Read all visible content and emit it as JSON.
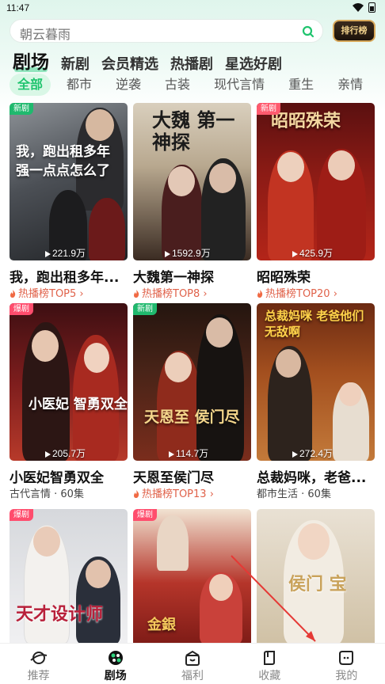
{
  "status_bar": {
    "time": "11:47"
  },
  "search": {
    "placeholder": "朝云暮雨",
    "rank_button": "排行榜"
  },
  "main_tabs": [
    {
      "label": "剧场",
      "active": true
    },
    {
      "label": "新剧"
    },
    {
      "label": "会员精选"
    },
    {
      "label": "热播剧"
    },
    {
      "label": "星选好剧"
    }
  ],
  "sub_tabs": [
    {
      "label": "全部",
      "active": true
    },
    {
      "label": "都市"
    },
    {
      "label": "逆袭"
    },
    {
      "label": "古装"
    },
    {
      "label": "现代言情"
    },
    {
      "label": "重生"
    },
    {
      "label": "亲情"
    }
  ],
  "cards": [
    {
      "badge": "新剧",
      "badge_type": "new",
      "poster_text": "我，跑出租多年 强一点点怎么了",
      "views": "221.9万",
      "title": "我，跑出租多年...",
      "meta": "热播榜TOP5",
      "meta_type": "rank"
    },
    {
      "badge": "",
      "poster_text": "大魏 第一神探",
      "views": "1592.9万",
      "title": "大魏第一神探",
      "meta": "热播榜TOP8",
      "meta_type": "rank"
    },
    {
      "badge": "新剧",
      "badge_type": "new",
      "poster_text": "昭昭殊荣",
      "views": "425.9万",
      "title": "昭昭殊荣",
      "meta": "热播榜TOP20",
      "meta_type": "rank"
    },
    {
      "badge": "爆剧",
      "badge_type": "hot",
      "poster_text": "小医妃 智勇双全",
      "views": "205.7万",
      "title": "小医妃智勇双全",
      "meta": "古代言情 · 60集",
      "meta_type": "plain"
    },
    {
      "badge": "新剧",
      "badge_type": "new",
      "poster_text": "天恩至 侯门尽",
      "views": "114.7万",
      "title": "天恩至侯门尽",
      "meta": "热播榜TOP13",
      "meta_type": "rank"
    },
    {
      "badge": "爆剧",
      "badge_type": "hot",
      "poster_text": "总裁妈咪 老爸他们无敌啊",
      "views": "272.4万",
      "title": "总裁妈咪，老爸...",
      "meta": "都市生活 · 60集",
      "meta_type": "plain"
    },
    {
      "badge": "爆剧",
      "badge_type": "hot",
      "poster_text": "天才设计师",
      "views": "",
      "title": "",
      "meta": ""
    },
    {
      "badge": "爆剧",
      "badge_type": "hot",
      "poster_text": "金銀",
      "views": "",
      "title": "",
      "meta": ""
    },
    {
      "badge": "",
      "poster_text": "侯门 宝",
      "views": "",
      "title": "",
      "meta": ""
    }
  ],
  "bottom_nav": [
    {
      "label": "推荐"
    },
    {
      "label": "剧场",
      "active": true
    },
    {
      "label": "福利"
    },
    {
      "label": "收藏"
    },
    {
      "label": "我的"
    }
  ],
  "colors": {
    "accent": "#1fc46e",
    "rank": "#e0624a",
    "hot_badge": "#ff4d6d",
    "new_badge": "#20b96e"
  }
}
